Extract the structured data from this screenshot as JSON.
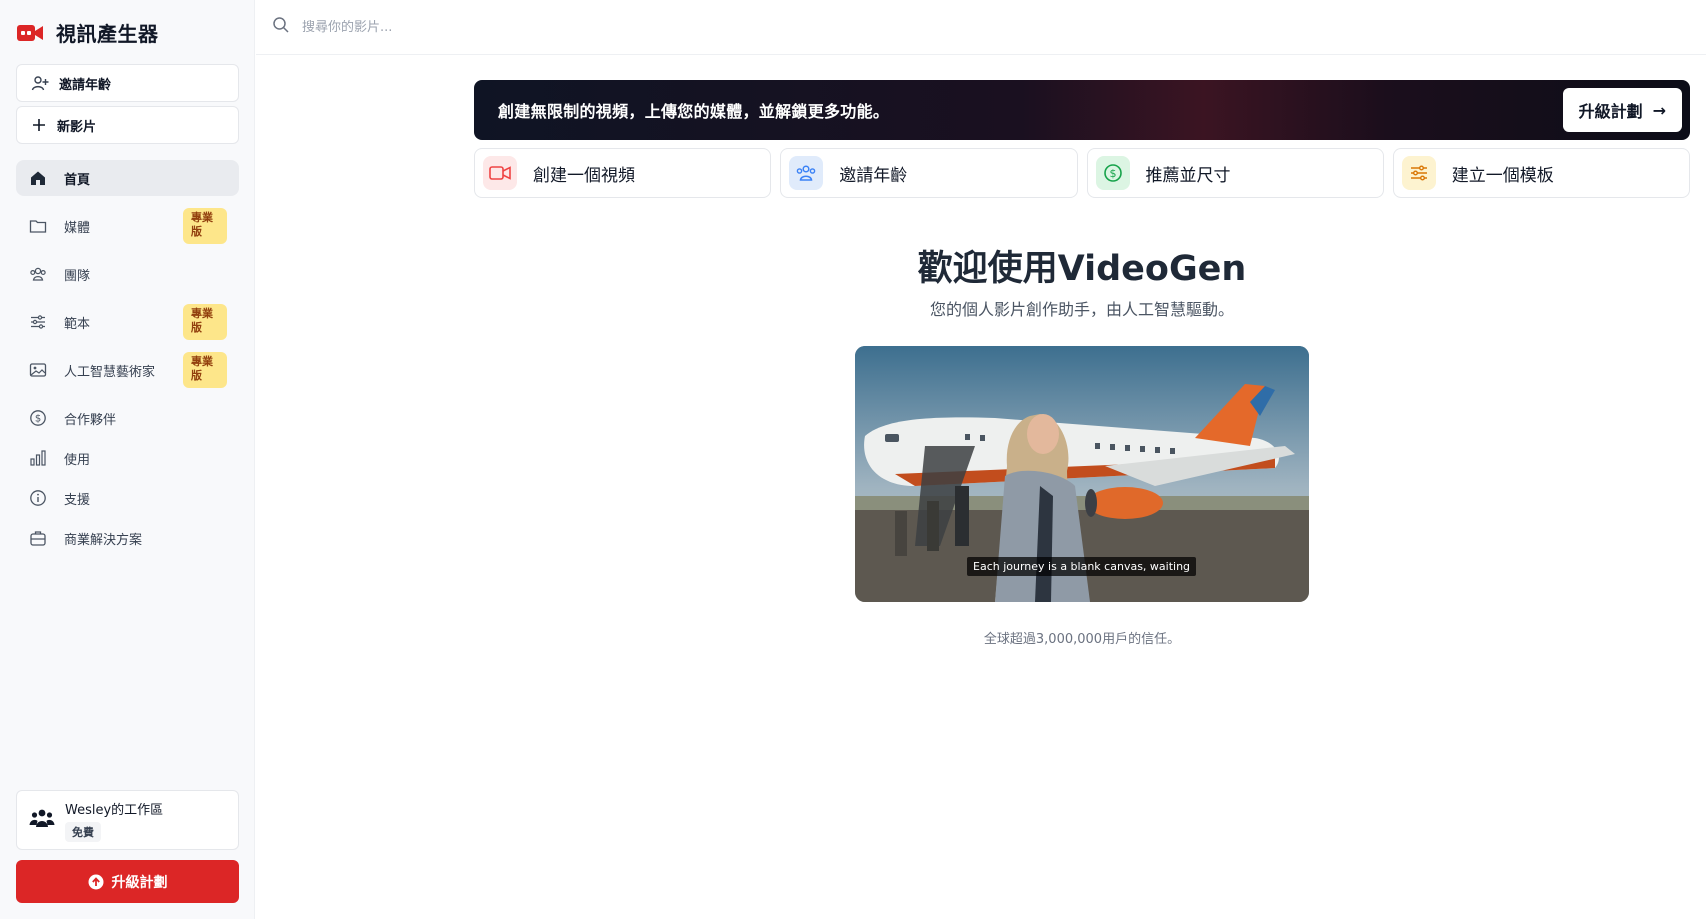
{
  "brand": {
    "title": "視訊產生器",
    "icon": "video-camera-icon",
    "color": "#dc2626"
  },
  "sidebar": {
    "invite_label": "邀請年齡",
    "new_video_label": "新影片",
    "items": [
      {
        "label": "首頁",
        "icon": "home-icon",
        "active": true
      },
      {
        "label": "媒體",
        "icon": "folder-icon",
        "badge": "專業版"
      },
      {
        "label": "團隊",
        "icon": "users-icon"
      },
      {
        "label": "範本",
        "icon": "sliders-icon",
        "badge": "專業版"
      },
      {
        "label": "人工智慧藝術家",
        "icon": "image-icon",
        "badge": "專業版"
      },
      {
        "label": "合作夥伴",
        "icon": "dollar-circle-icon"
      },
      {
        "label": "使用",
        "icon": "bar-chart-icon"
      },
      {
        "label": "支援",
        "icon": "info-icon"
      },
      {
        "label": "商業解決方案",
        "icon": "briefcase-icon"
      }
    ],
    "workspace": {
      "name": "Wesley的工作區",
      "plan": "免費"
    },
    "upgrade_label": "升級計劃"
  },
  "search": {
    "placeholder": "搜尋你的影片..."
  },
  "banner": {
    "text": "創建無限制的視頻，上傳您的媒體，並解鎖更多功能。",
    "button_label": "升級計劃",
    "button_arrow": "→"
  },
  "cards": [
    {
      "label": "創建一個視頻",
      "icon": "video-icon",
      "color": "#ef4444",
      "bg": "#fde8e8"
    },
    {
      "label": "邀請年齡",
      "icon": "users-icon",
      "color": "#3b82f6",
      "bg": "#e0ebfb"
    },
    {
      "label": "推薦並尺寸",
      "icon": "dollar-circle-icon",
      "color": "#16a34a",
      "bg": "#dcf5e3"
    },
    {
      "label": "建立一個模板",
      "icon": "sliders-icon",
      "color": "#d97706",
      "bg": "#fdf3d0"
    }
  ],
  "welcome": {
    "title": "歡迎使用VideoGen",
    "subtitle": "您的個人影片創作助手，由人工智慧驅動。",
    "caption": "Each journey is a blank canvas, waiting",
    "trust": "全球超過3,000,000用戶的信任。"
  }
}
